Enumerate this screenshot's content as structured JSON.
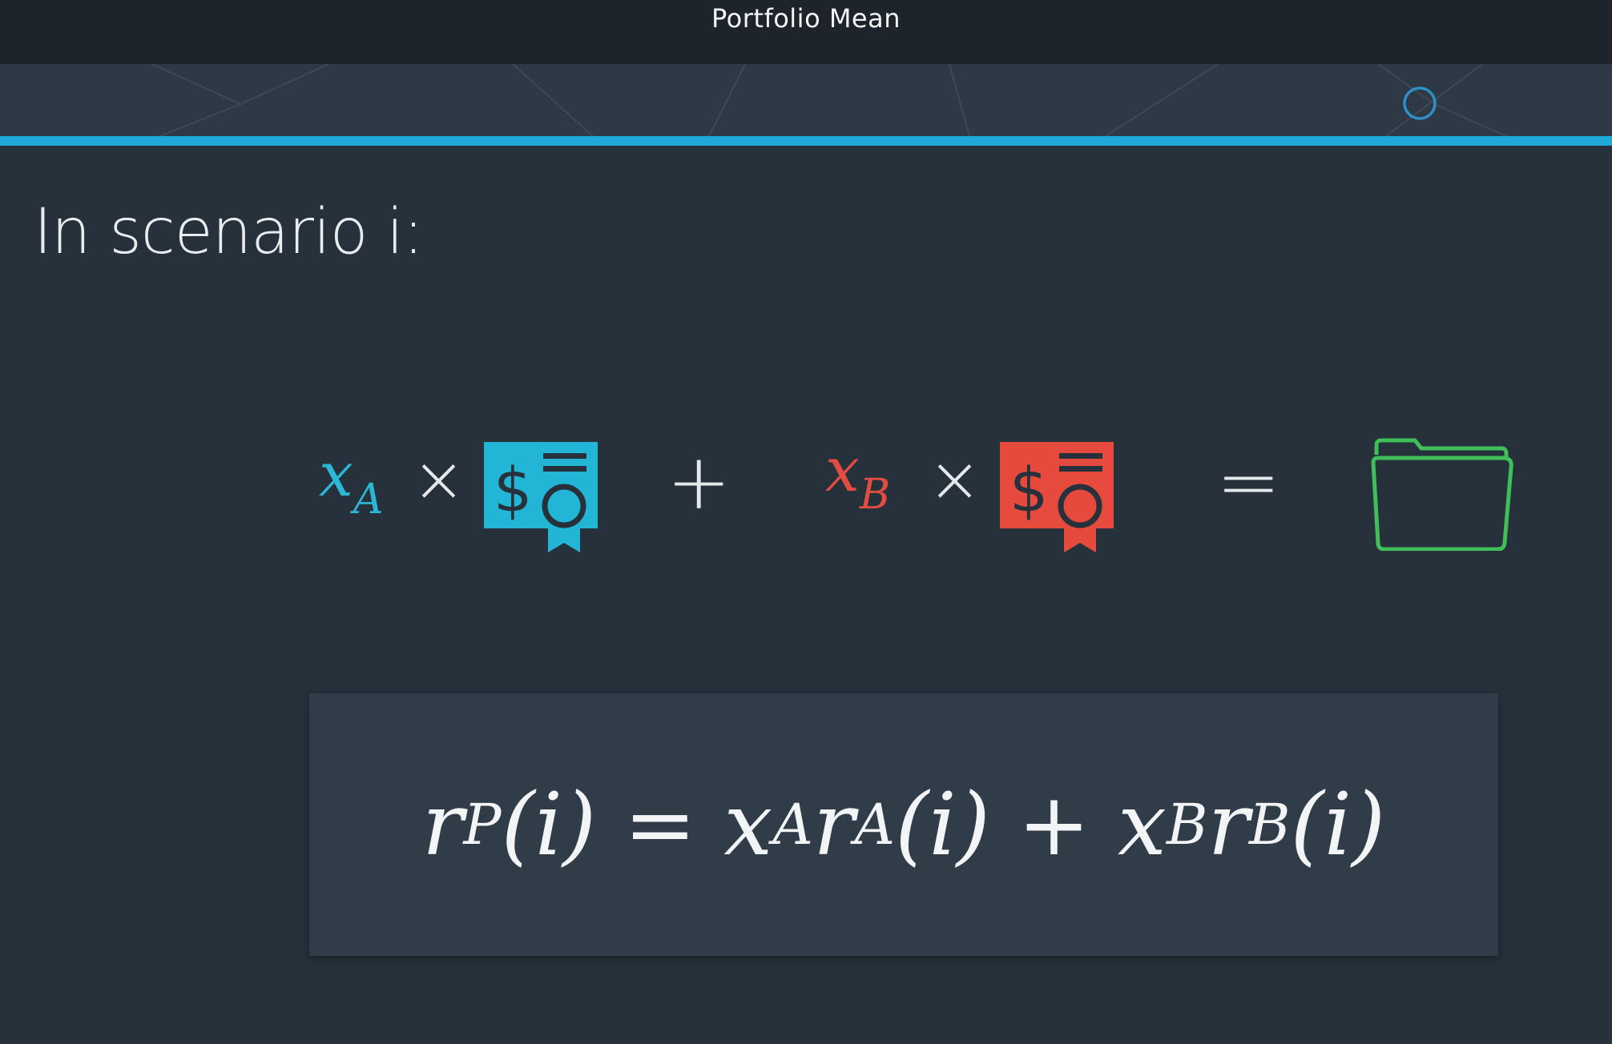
{
  "window": {
    "title": "Portfolio Mean"
  },
  "slide": {
    "heading": "In scenario i:",
    "equation_row": {
      "term_a": {
        "var": "x",
        "sub": "A",
        "color": "#2ab8d6",
        "icon": "stock-certificate-icon"
      },
      "times": "×",
      "plus": "+",
      "term_b": {
        "var": "x",
        "sub": "B",
        "color": "#e34c40",
        "icon": "stock-certificate-icon"
      },
      "equals": "=",
      "result_icon": "folder-icon",
      "result_color": "#3fbf5a"
    },
    "formula": {
      "rp": "r",
      "rp_sub": "P",
      "i1": "(i) = x",
      "xa_sub": "A",
      "ra": "r",
      "ra_sub": "A",
      "i2": "(i) + x",
      "xb_sub": "B",
      "rb": "r",
      "rb_sub": "B",
      "i3": "(i)"
    }
  },
  "colors": {
    "background": "#27313b",
    "accent_line": "#1fa9d9",
    "stock_a": "#23b5d6",
    "stock_b": "#e64a3c",
    "portfolio": "#3fbf5a"
  }
}
